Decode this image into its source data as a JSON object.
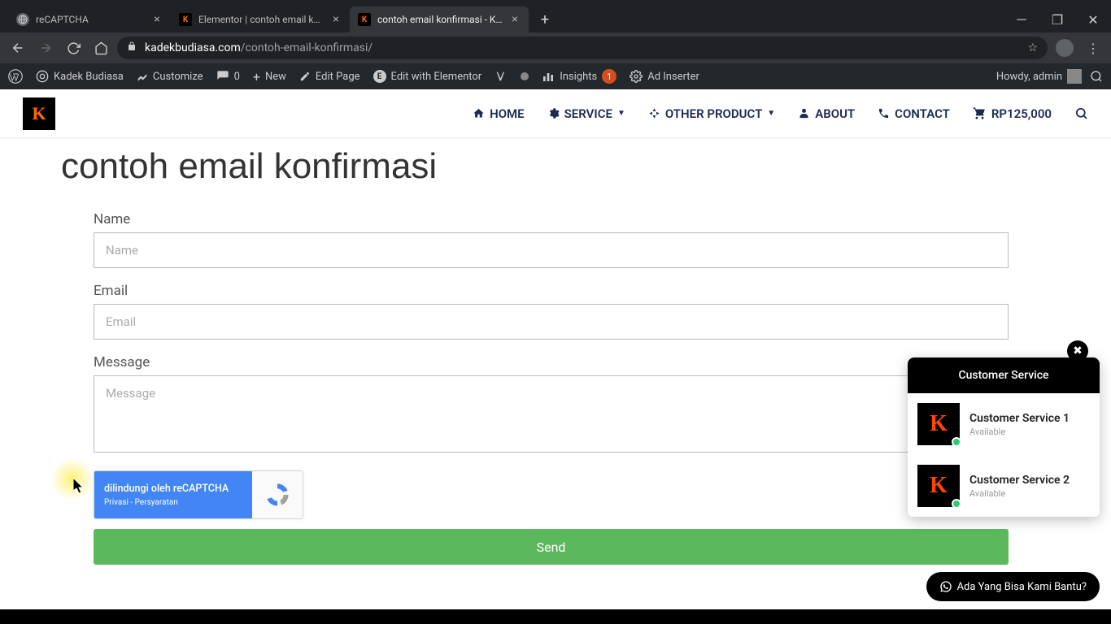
{
  "browser": {
    "tabs": [
      {
        "title": "reCAPTCHA",
        "favicon_bg": "#5f6368"
      },
      {
        "title": "Elementor | contoh email konfirm",
        "favicon_letter": "K"
      },
      {
        "title": "contoh email konfirmasi - Kadek",
        "favicon_letter": "K"
      }
    ],
    "url_domain": "kadekbudiasa.com",
    "url_path": "/contoh-email-konfirmasi/"
  },
  "wp_bar": {
    "site_name": "Kadek Budiasa",
    "customize": "Customize",
    "comments_count": "0",
    "new": "New",
    "edit_page": "Edit Page",
    "edit_elementor": "Edit with Elementor",
    "insights": "Insights",
    "insights_badge": "1",
    "ad_inserter": "Ad Inserter",
    "howdy": "Howdy, admin"
  },
  "site_nav": {
    "logo_letter": "K",
    "home": "HOME",
    "service": "SERVICE",
    "other_product": "OTHER PRODUCT",
    "about": "ABOUT",
    "contact": "CONTACT",
    "cart_amount": "RP125,000"
  },
  "page": {
    "title": "contoh email konfirmasi",
    "form": {
      "name_label": "Name",
      "name_placeholder": "Name",
      "email_label": "Email",
      "email_placeholder": "Email",
      "message_label": "Message",
      "message_placeholder": "Message",
      "recaptcha_text": "dilindungi oleh reCAPTCHA",
      "recaptcha_privacy": "Privasi",
      "recaptcha_sep": " - ",
      "recaptcha_terms": "Persyaratan",
      "send": "Send"
    }
  },
  "cs": {
    "header": "Customer Service",
    "agents": [
      {
        "name": "Customer Service 1",
        "status": "Available"
      },
      {
        "name": "Customer Service 2",
        "status": "Available"
      }
    ],
    "help_text": "Ada Yang Bisa Kami Bantu?"
  }
}
